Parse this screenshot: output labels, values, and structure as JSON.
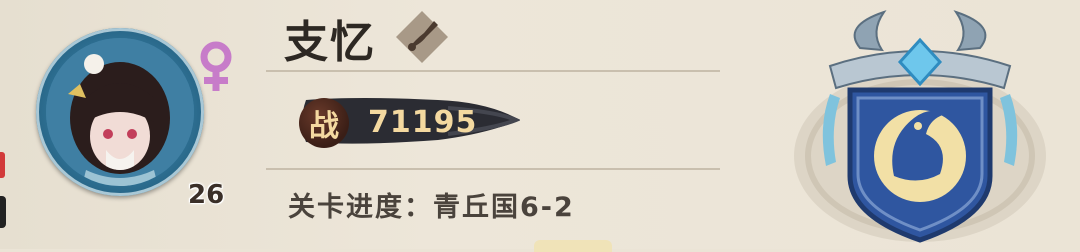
{
  "character": {
    "name": "支忆",
    "level": "26",
    "gender_icon": "female-icon",
    "class_icon": "brush-icon",
    "power_label": "战",
    "power_value": "71195",
    "progress_text": "关卡进度：青丘国6-2"
  },
  "emblem": {
    "icon": "fish-shield-emblem-icon"
  },
  "colors": {
    "panel": "#ebe4d6",
    "avatar_ring": "#2d6f92",
    "gender": "#c77cc9",
    "power_text": "#f4d9a0",
    "emblem_blue": "#2f56a0"
  }
}
